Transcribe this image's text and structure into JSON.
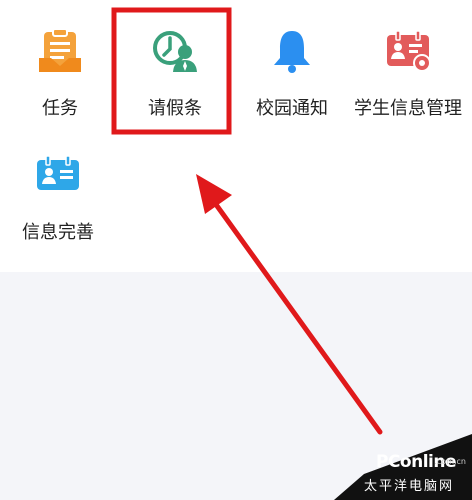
{
  "menu": {
    "items": [
      {
        "label": "任务",
        "icon": "task-clipboard-icon",
        "color": "#f4a23b"
      },
      {
        "label": "请假条",
        "icon": "leave-request-icon",
        "color": "#3aa07b"
      },
      {
        "label": "校园通知",
        "icon": "bell-icon",
        "color": "#2b8ff0"
      },
      {
        "label": "学生信息管理",
        "icon": "student-card-settings-icon",
        "color": "#e25b5b"
      },
      {
        "label": "信息完善",
        "icon": "id-card-icon",
        "color": "#2ea7e8"
      }
    ]
  },
  "highlight": {
    "target": "请假条",
    "color": "#e0191b"
  },
  "watermark": {
    "brand": "PConline",
    "suffix": ".com.cn",
    "cn_name": "太平洋电脑网"
  }
}
